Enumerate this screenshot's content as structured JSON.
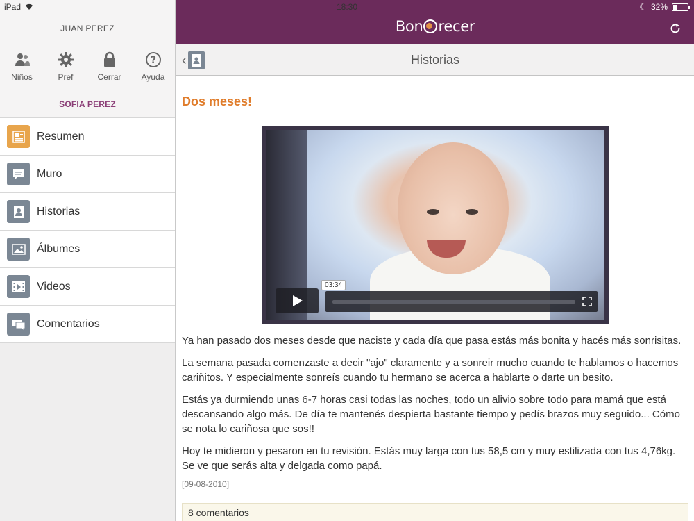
{
  "status_bar": {
    "device": "iPad",
    "time": "18:30",
    "battery": "32%",
    "battery_level": 0.32
  },
  "sidebar": {
    "user_name": "JUAN PEREZ",
    "quick_actions": [
      {
        "label": "Niños",
        "icon": "children-icon"
      },
      {
        "label": "Pref",
        "icon": "gear-icon"
      },
      {
        "label": "Cerrar",
        "icon": "lock-icon"
      },
      {
        "label": "Ayuda",
        "icon": "help-icon"
      }
    ],
    "child_name": "SOFIA PEREZ",
    "menu": [
      {
        "label": "Resumen",
        "icon": "summary-icon",
        "active": true
      },
      {
        "label": "Muro",
        "icon": "wall-icon",
        "active": false
      },
      {
        "label": "Historias",
        "icon": "stories-icon",
        "active": false
      },
      {
        "label": "Álbumes",
        "icon": "album-icon",
        "active": false
      },
      {
        "label": "Videos",
        "icon": "video-icon",
        "active": false
      },
      {
        "label": "Comentarios",
        "icon": "comments-icon",
        "active": false
      }
    ]
  },
  "header": {
    "logo_left": "Bon",
    "logo_right": "recer",
    "page_title": "Historias"
  },
  "story": {
    "title": "Dos meses!",
    "video_time": "03:34",
    "paragraphs": [
      "Ya han pasado dos meses desde que naciste y cada día que pasa estás más bonita y hacés más sonrisitas.",
      "La semana pasada comenzaste a decir \"ajo\" claramente y a sonreir mucho cuando te hablamos o hacemos cariñitos. Y especialmente sonreís cuando tu hermano se acerca a hablarte o darte un besito.",
      "Estás ya durmiendo unas 6-7 horas casi todas las noches, todo un alivio sobre todo para mamá que está descansando algo más. De día te mantenés despierta bastante tiempo y pedís brazos muy seguido... Cómo se nota lo cariñosa que sos!!",
      "Hoy te midieron y pesaron en tu revisión. Estás muy larga con tus 58,5 cm y muy estilizada con tus 4,76kg. Se ve que serás alta y delgada como papá."
    ],
    "date": "[09-08-2010]",
    "comments": "8 comentarios"
  },
  "colors": {
    "brand": "#6b2b5b",
    "accent_orange": "#e07d2c",
    "child_name": "#8b3f77"
  }
}
